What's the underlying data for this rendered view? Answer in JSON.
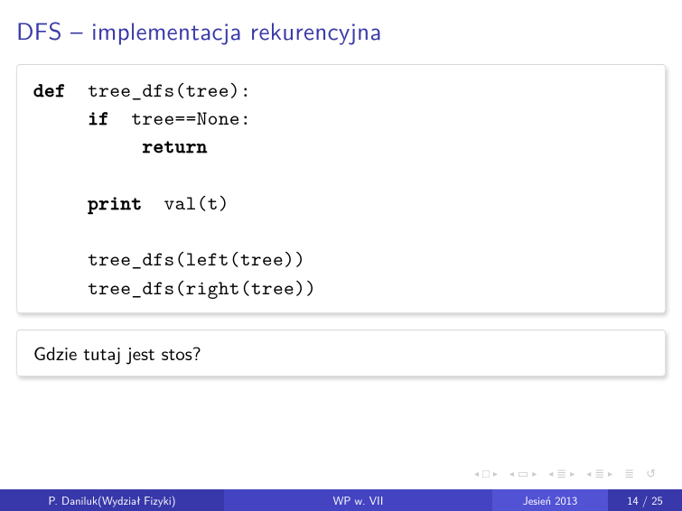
{
  "title": "DFS – implementacja rekurencyjna",
  "code": {
    "l1a": "def",
    "l1b": "  tree_dfs(tree):",
    "l2a": "     if",
    "l2b": "  tree==None:",
    "l3a": "          return",
    "l4": " ",
    "l5a": "     print",
    "l5b": "  val(t)",
    "l6": " ",
    "l7": "     tree_dfs(left(tree))",
    "l8": "     tree_dfs(right(tree))"
  },
  "question": "Gdzie tutaj jest stos?",
  "footer": {
    "author": "P. Daniluk(Wydział Fizyki)",
    "center": "WP w. VII",
    "term": "Jesień 2013",
    "page": "14 / 25"
  },
  "nav": {
    "first": "◂ □ ▸",
    "prev": "◂ ▭ ▸",
    "next": "◂ ≣ ▸",
    "last": "◂ ≣ ▸",
    "mode": "≣",
    "refresh": "↻९૯"
  }
}
